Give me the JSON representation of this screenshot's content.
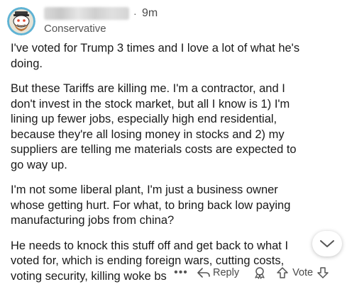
{
  "comment": {
    "author": "",
    "time": "9m",
    "flair": "Conservative",
    "paragraphs": [
      "I've voted for Trump 3 times and I love a lot of what he's doing.",
      "But these Tariffs are killing me. I'm a contractor, and I don't invest in the stock market, but all I know is 1) I'm lining up fewer jobs, especially high end residential, because they're all losing money in stocks and 2) my suppliers are telling me materials costs are expected to go way up.",
      "I'm not some liberal plant, I'm just a business owner whose getting hurt. For what, to bring back low paying manufacturing jobs from china?",
      "He needs to knock this stuff off and get back to what I voted for, which is ending foreign wars, cutting costs, voting security, killing woke bs"
    ]
  },
  "actions": {
    "more": "•••",
    "reply_label": "Reply",
    "vote_label": "Vote"
  },
  "icons": {
    "avatar": "snoo-avatar-icon",
    "collapse": "chevron-down-icon",
    "reply": "reply-arrow-icon",
    "award": "award-icon",
    "upvote": "upvote-arrow-icon",
    "downvote": "downvote-arrow-icon"
  },
  "colors": {
    "text": "#1a1a1a",
    "meta": "#555555",
    "avatar_bg": "#55aacc"
  }
}
